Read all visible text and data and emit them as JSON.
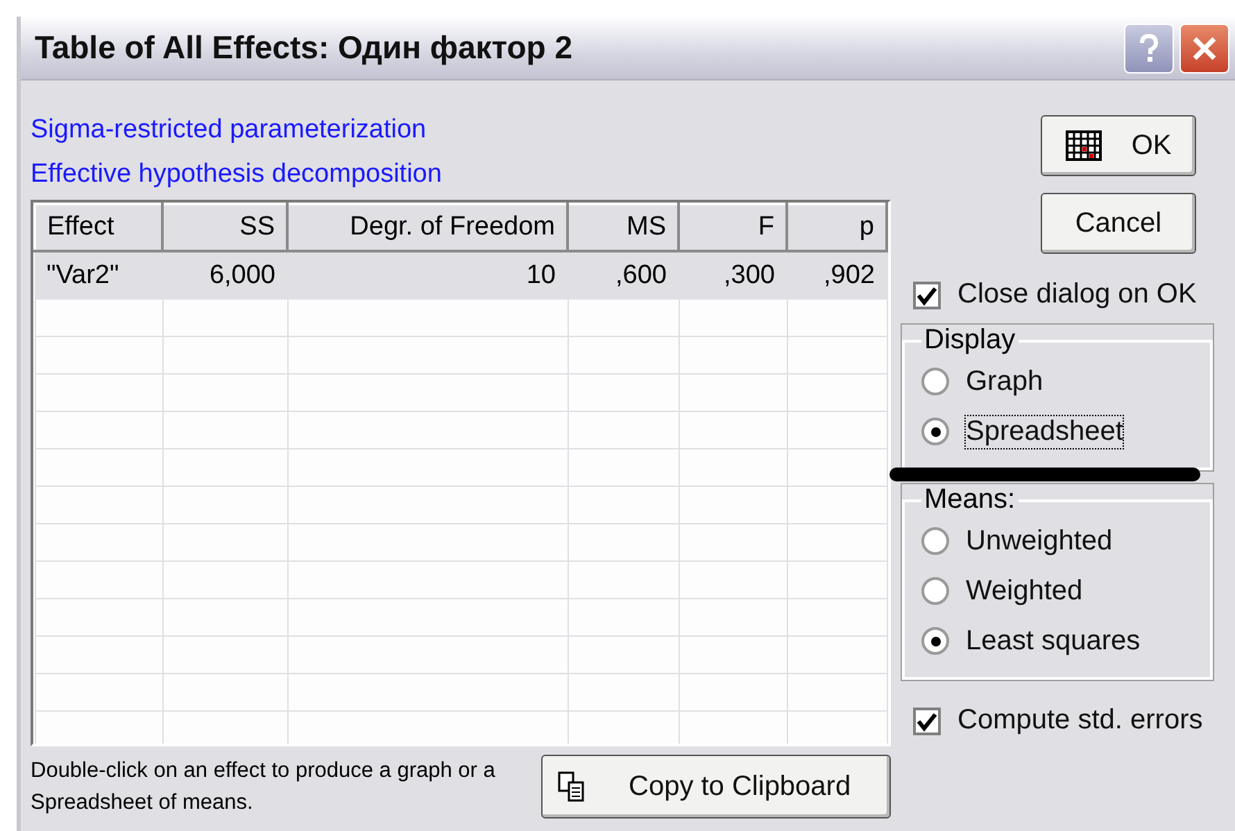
{
  "window": {
    "title": "Table of All Effects: Один фактор 2"
  },
  "info_lines": [
    "Sigma-restricted parameterization",
    "Effective hypothesis decomposition"
  ],
  "table": {
    "columns": [
      "Effect",
      "SS",
      "Degr. of Freedom",
      "MS",
      "F",
      "p"
    ],
    "rows": [
      [
        "\"Var2\"",
        "6,000",
        "10",
        ",600",
        ",300",
        ",902"
      ]
    ]
  },
  "buttons": {
    "ok": "OK",
    "cancel": "Cancel",
    "copy": "Copy to Clipboard"
  },
  "close_on_ok": {
    "label": "Close dialog on OK",
    "checked": true
  },
  "display": {
    "title": "Display",
    "options": [
      {
        "label": "Graph",
        "selected": false
      },
      {
        "label": "Spreadsheet",
        "selected": true
      }
    ]
  },
  "means": {
    "title": "Means:",
    "options": [
      {
        "label": "Unweighted",
        "selected": false
      },
      {
        "label": "Weighted",
        "selected": false
      },
      {
        "label": "Least squares",
        "selected": true
      }
    ]
  },
  "compute_errors": {
    "label": "Compute std. errors",
    "checked": true
  },
  "hint": "Double-click on an effect to produce a graph or a Spreadsheet of means."
}
